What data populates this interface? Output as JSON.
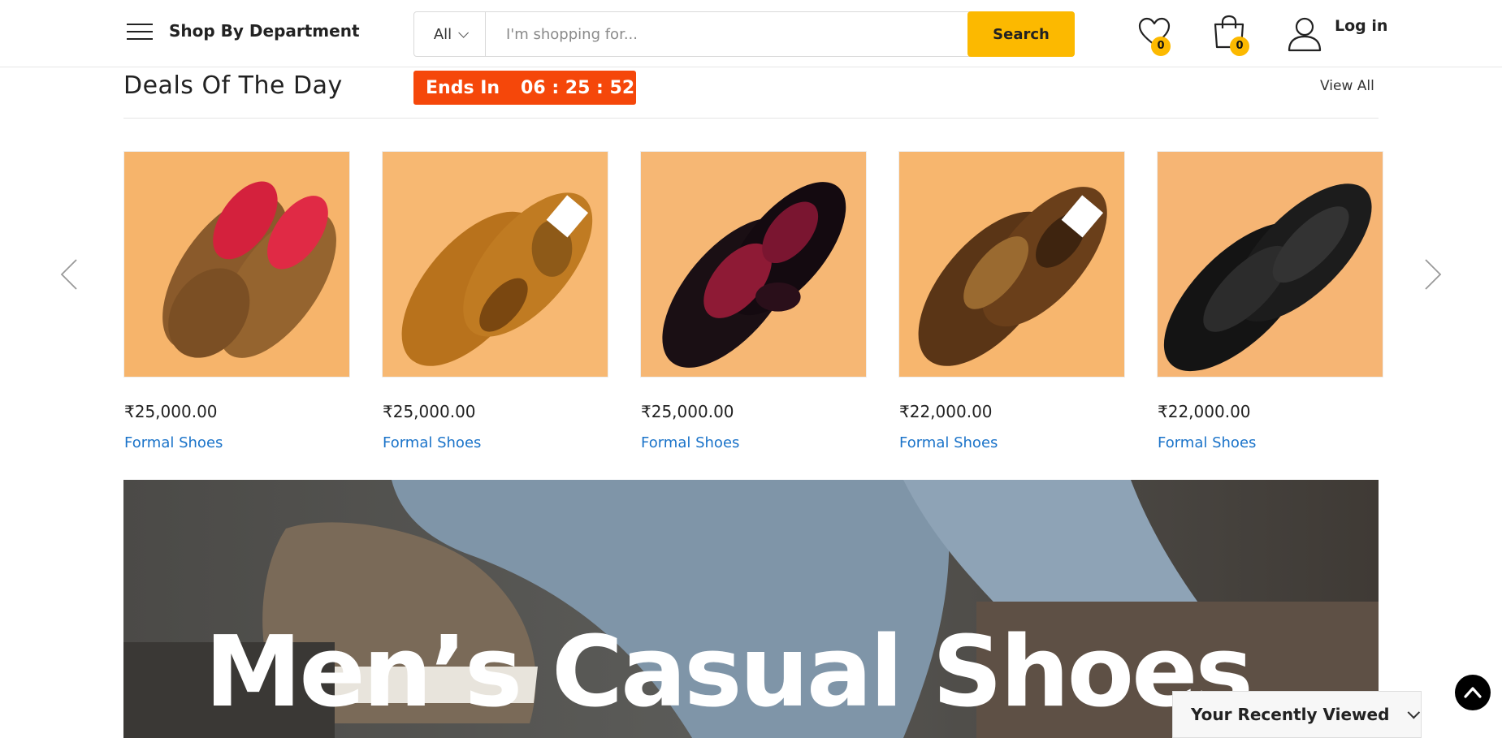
{
  "header": {
    "department_label": "Shop By Department",
    "category_selected": "All",
    "search_placeholder": "I'm shopping for...",
    "search_button": "Search",
    "wishlist_count": "0",
    "cart_count": "0",
    "login_label": "Log in",
    "accent_color": "#fcb900"
  },
  "deals": {
    "title": "Deals Of The Day",
    "countdown_label": "Ends In",
    "countdown_time": "06 : 25 : 52",
    "view_all": "View All",
    "products": [
      {
        "price": "₹25,000.00",
        "category": "Formal Shoes",
        "image": "brown-suede-loafer"
      },
      {
        "price": "₹25,000.00",
        "category": "Formal Shoes",
        "image": "tan-crocodile-loafer"
      },
      {
        "price": "₹25,000.00",
        "category": "Formal Shoes",
        "image": "black-red-patent-loafer"
      },
      {
        "price": "₹22,000.00",
        "category": "Formal Shoes",
        "image": "brown-glossy-loafer"
      },
      {
        "price": "₹22,000.00",
        "category": "Formal Shoes",
        "image": "black-woven-lace-up"
      }
    ]
  },
  "banner": {
    "title": "Men’s Casual Shoes"
  },
  "recently_viewed": {
    "label": "Your Recently Viewed"
  }
}
